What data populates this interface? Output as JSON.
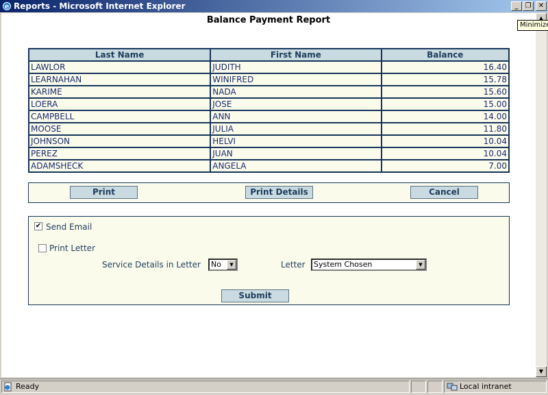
{
  "window": {
    "title": "Reports - Microsoft Internet Explorer",
    "minimize_label": "_",
    "maximize_label": "❐",
    "close_label": "✕",
    "tooltip": "Minimize"
  },
  "report": {
    "title": "Balance Payment Report",
    "columns": [
      "Last Name",
      "First Name",
      "Balance"
    ],
    "rows": [
      [
        "LAWLOR",
        "JUDITH",
        "16.40"
      ],
      [
        "LEARNAHAN",
        "WINIFRED",
        "15.78"
      ],
      [
        "KARIME",
        "NADA",
        "15.60"
      ],
      [
        "LOERA",
        "JOSE",
        "15.00"
      ],
      [
        "CAMPBELL",
        "ANN",
        "14.00"
      ],
      [
        "MOOSE",
        "JULIA",
        "11.80"
      ],
      [
        "JOHNSON",
        "HELVI",
        "10.04"
      ],
      [
        "PEREZ",
        "JUAN",
        "10.04"
      ],
      [
        "ADAMSHECK",
        "ANGELA",
        "7.00"
      ]
    ]
  },
  "actions": {
    "print": "Print",
    "print_details": "Print Details",
    "cancel": "Cancel"
  },
  "options": {
    "send_email_label": "Send Email",
    "send_email_checked": true,
    "print_letter_label": "Print Letter",
    "print_letter_checked": false,
    "service_details_label": "Service Details in Letter",
    "service_details_value": "No",
    "letter_label": "Letter",
    "letter_value": "System Chosen",
    "submit": "Submit"
  },
  "statusbar": {
    "status": "Ready",
    "zone": "Local intranet"
  },
  "colors": {
    "header_bg": "#c9dbe1",
    "border": "#14345a",
    "row_bg": "#fbfbec",
    "text": "#1d3d5c"
  }
}
